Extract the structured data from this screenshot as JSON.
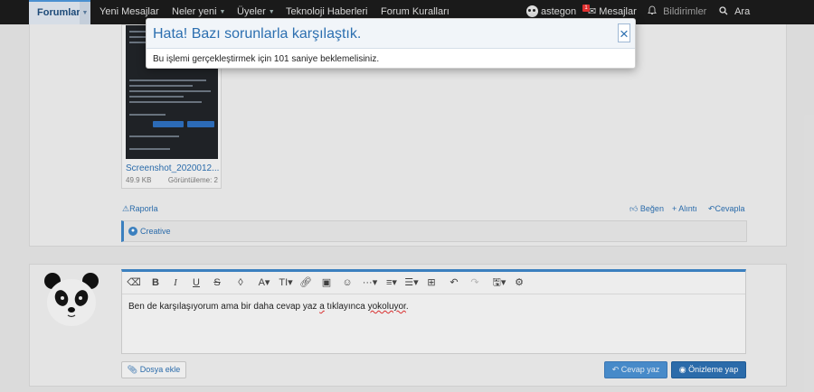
{
  "nav": {
    "forums": "Forumlar",
    "new_messages": "Yeni Mesajlar",
    "whats_new": "Neler yeni",
    "members": "Üyeler",
    "tech_news": "Teknoloji Haberleri",
    "forum_rules": "Forum Kuralları",
    "username": "astegon",
    "messages": "Mesajlar",
    "messages_badge": "1",
    "notifications": "Bildirimler",
    "search": "Ara"
  },
  "attachment": {
    "filename": "Screenshot_2020012...",
    "size": "49.9 KB",
    "views": "Görüntüleme: 2"
  },
  "post_actions": {
    "report": "Raporla",
    "like": "Beğen",
    "quote": "+ Alıntı",
    "reply": "Cevapla"
  },
  "reactions": {
    "label": "Creative"
  },
  "editor": {
    "text_a": "Ben de karşılaşıyorum ama bir daha cevap yaz ",
    "text_b": "a",
    "text_c": " tıklayınca ",
    "text_d": "yokoluyor",
    "text_e": ".",
    "attach_files": "Dosya ekle",
    "post_reply": "Cevap yaz",
    "preview": "Önizleme yap"
  },
  "modal": {
    "title": "Hata! Bazı sorunlarla karşılaştık.",
    "message": "Bu işlemi gerçekleştirmek için 101 saniye beklemelisiniz.",
    "close": "×"
  },
  "colors": {
    "accent": "#2c6fb0",
    "navbar": "#1a1a1a",
    "button_primary": "#2d6fb0",
    "badge": "#e03030"
  }
}
